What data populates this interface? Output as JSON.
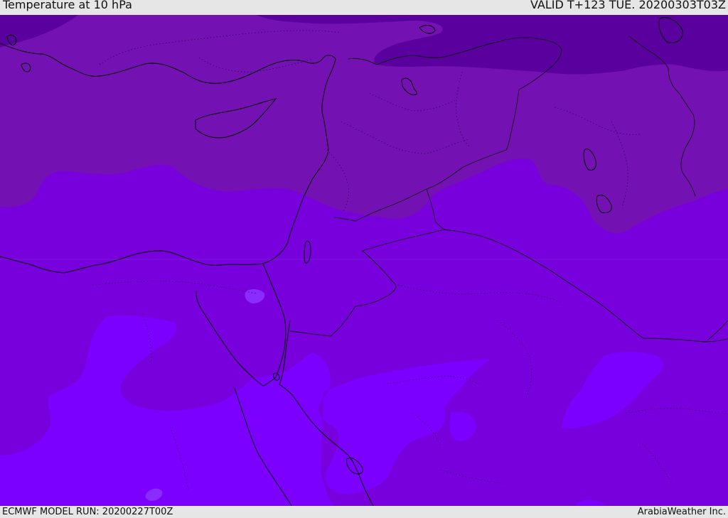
{
  "header": {
    "title": "Temperature at 10 hPa",
    "valid": "VALID T+123 TUE. 20200303T03Z"
  },
  "footer": {
    "model_run": "ECMWF MODEL RUN: 20200227T00Z",
    "credit": "ArabiaWeather Inc."
  },
  "colors": {
    "band_darkest": "#5a009e",
    "band_dark": "#7311b3",
    "band_mid": "#7800dc",
    "band_light": "#7c00ff",
    "band_lighter": "#8a2cff",
    "coastline": "#000000"
  }
}
